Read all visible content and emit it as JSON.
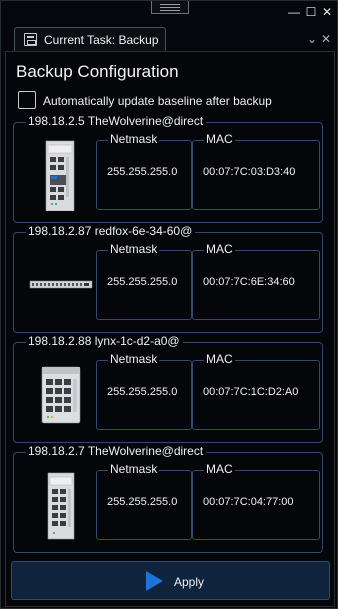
{
  "window": {
    "minimize_glyph": "—",
    "maximize_glyph": "☐",
    "close_glyph": "✕"
  },
  "tab": {
    "label": "Current Task: Backup",
    "icon": "backup-task-icon",
    "menu_glyph": "⌄",
    "close_glyph": "✕"
  },
  "panel": {
    "heading": "Backup Configuration",
    "checkbox_label": "Automatically update baseline after backup",
    "checkbox_checked": false
  },
  "devices": [
    {
      "title": "198.18.2.5 TheWolverine@direct",
      "image": "wolverine-switch-image",
      "netmask_label": "Netmask",
      "netmask": "255.255.255.0",
      "mac_label": "MAC",
      "mac": "00:07:7C:03:D3:40"
    },
    {
      "title": "198.18.2.87 redfox-6e-34-60@",
      "image": "redfox-rack-switch-image",
      "netmask_label": "Netmask",
      "netmask": "255.255.255.0",
      "mac_label": "MAC",
      "mac": "00:07:7C:6E:34:60"
    },
    {
      "title": "198.18.2.88 lynx-1c-d2-a0@",
      "image": "lynx-switch-image",
      "netmask_label": "Netmask",
      "netmask": "255.255.255.0",
      "mac_label": "MAC",
      "mac": "00:07:7C:1C:D2:A0"
    },
    {
      "title": "198.18.2.7 TheWolverine@direct",
      "image": "wolverine-switch-image",
      "netmask_label": "Netmask",
      "netmask": "255.255.255.0",
      "mac_label": "MAC",
      "mac": "00:07:7C:04:77:00"
    }
  ],
  "apply": {
    "label": "Apply",
    "icon": "play-icon",
    "icon_color": "#1e73d8"
  }
}
